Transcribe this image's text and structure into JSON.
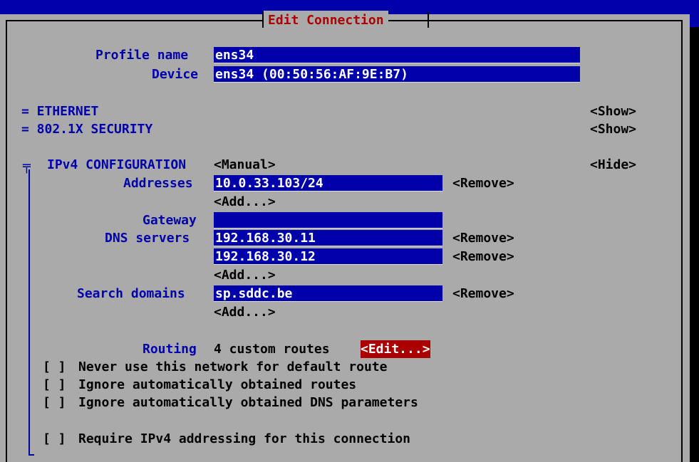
{
  "dialog": {
    "title": "Edit Connection"
  },
  "profile": {
    "name_label": "Profile name",
    "name_value": "ens34",
    "device_label": "Device",
    "device_value": "ens34 (00:50:56:AF:9E:B7)"
  },
  "sections": {
    "ethernet": {
      "label": "= ETHERNET",
      "toggle": "<Show>"
    },
    "security": {
      "label": "= 802.1X SECURITY",
      "toggle": "<Show>"
    },
    "ipv4": {
      "marker": "╤",
      "label": "IPv4 CONFIGURATION",
      "mode": "<Manual>",
      "toggle": "<Hide>"
    }
  },
  "ipv4": {
    "addresses_label": "Addresses",
    "addresses": [
      "10.0.33.103/24"
    ],
    "gateway_label": "Gateway",
    "gateway_value": "",
    "dns_label": "DNS servers",
    "dns": [
      "192.168.30.11",
      "192.168.30.12"
    ],
    "search_label": "Search domains",
    "search": [
      "sp.sddc.be"
    ],
    "remove_label": "<Remove>",
    "add_label": "<Add...>",
    "routing_label": "Routing",
    "routing_value": "4 custom routes",
    "routing_edit": "<Edit...>",
    "checkboxes": [
      {
        "box": "[ ]",
        "label": "Never use this network for default route"
      },
      {
        "box": "[ ]",
        "label": "Ignore automatically obtained routes"
      },
      {
        "box": "[ ]",
        "label": "Ignore automatically obtained DNS parameters"
      },
      {
        "box": "[ ]",
        "label": "Require IPv4 addressing for this connection"
      }
    ]
  },
  "colors": {
    "background": "#0000aa",
    "dialog": "#aaaaaa",
    "field": "#0000aa",
    "title": "#aa0000",
    "highlight": "#aa0000"
  }
}
